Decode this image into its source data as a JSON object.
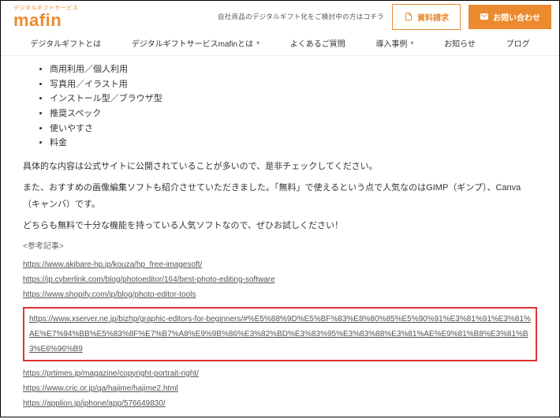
{
  "brand": {
    "tagline": "デジタルギフトサービス",
    "name": "mafin"
  },
  "header": {
    "cta_text": "自社商品のデジタルギフト化をご検討中の方はコチラ",
    "doc_btn": "資料請求",
    "contact_btn": "お問い合わせ"
  },
  "nav": {
    "item1": "デジタルギフトとは",
    "item2": "デジタルギフトサービスmafinとは",
    "item3": "よくあるご質問",
    "item4": "導入事例",
    "item5": "お知らせ",
    "item6": "ブログ"
  },
  "bullets": {
    "b1": "商用利用／個人利用",
    "b2": "写真用／イラスト用",
    "b3": "インストール型／ブラウザ型",
    "b4": "推奨スペック",
    "b5": "使いやすさ",
    "b6": "料金"
  },
  "paras": {
    "p1": "具体的な内容は公式サイトに公開されていることが多いので、是非チェックしてください。",
    "p2": "また、おすすめの画像編集ソフトも紹介させていただきました。「無料」で使えるという点で人気なのはGIMP（ギンプ）、Canva（キャンバ）です。",
    "p3": "どちらも無料で十分な機能を持っている人気ソフトなので、ぜひお試しください！"
  },
  "ref_heading": "<参考記事>",
  "refs": {
    "r1": "https://www.akibare-hp.jp/kouza/hp_free-imagesoft/",
    "r2": "https://jp.cyberlink.com/blog/photoeditor/164/best-photo-editing-software",
    "r3": "https://www.shopify.com/jp/blog/photo-editor-tools",
    "r4": "https://www.xserver.ne.jp/bizhp/graphic-editors-for-beginners/#%E5%88%9D%E5%BF%83%E8%80%85%E5%90%91%E3%81%91%E3%81%AE%E7%94%BB%E5%83%8F%E7%B7%A8%E9%9B%86%E3%82%BD%E3%83%95%E3%83%88%E3%81%AE%E9%81%B8%E3%81%B3%E6%96%B9",
    "r5": "https://prtimes.jp/magazine/copyright-portrait-right/",
    "r6": "https://www.cric.or.jp/qa/hajime/hajime2.html",
    "r7": "https://applion.jp/iphone/app/576649830/"
  }
}
